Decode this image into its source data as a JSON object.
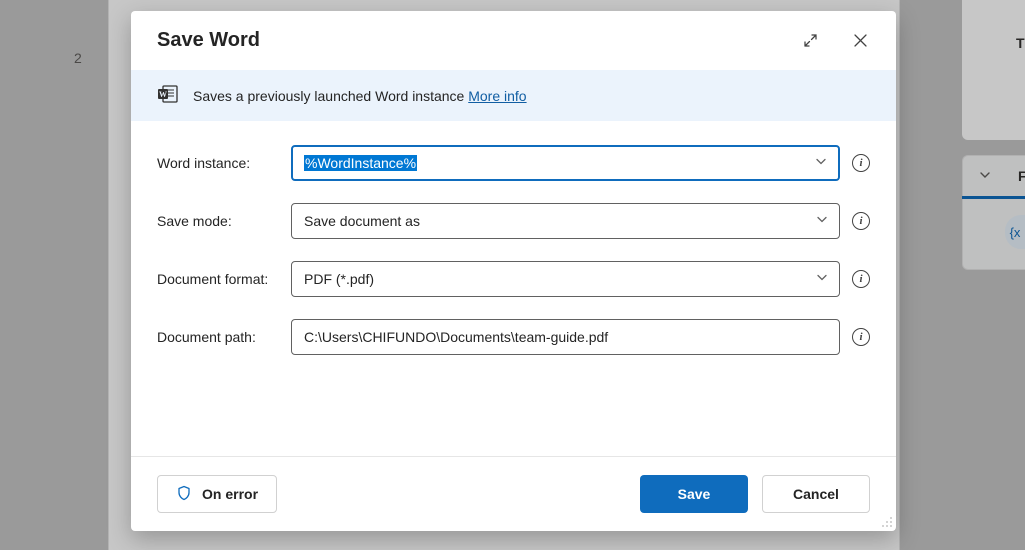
{
  "background": {
    "line_number": "2",
    "side_letter_top": "T",
    "side_letter_section": "F",
    "side_pill": "{x"
  },
  "dialog": {
    "title": "Save Word",
    "banner": {
      "text": "Saves a previously launched Word instance ",
      "link": "More info"
    },
    "fields": {
      "word_instance": {
        "label": "Word instance:",
        "value": "%WordInstance%"
      },
      "save_mode": {
        "label": "Save mode:",
        "value": "Save document as"
      },
      "document_format": {
        "label": "Document format:",
        "value": "PDF (*.pdf)"
      },
      "document_path": {
        "label": "Document path:",
        "value": "C:\\Users\\CHIFUNDO\\Documents\\team-guide.pdf"
      }
    },
    "footer": {
      "on_error": "On error",
      "save": "Save",
      "cancel": "Cancel"
    }
  }
}
